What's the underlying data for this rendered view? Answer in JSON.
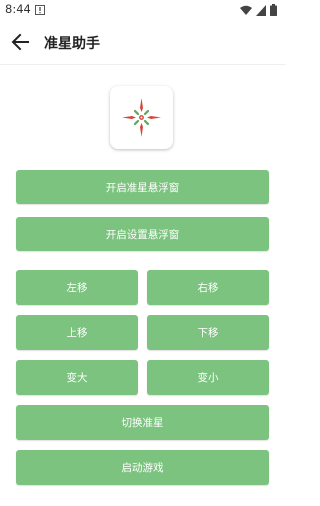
{
  "status_bar": {
    "time": "8:44"
  },
  "app_bar": {
    "title": "准星助手"
  },
  "buttons": {
    "open_crosshair_float": "开启准星悬浮窗",
    "open_settings_float": "开启设置悬浮窗",
    "move_left": "左移",
    "move_right": "右移",
    "move_up": "上移",
    "move_down": "下移",
    "enlarge": "变大",
    "shrink": "变小",
    "switch_crosshair": "切换准星",
    "launch_game": "启动游戏"
  },
  "colors": {
    "button_bg": "#7dc380",
    "button_text": "#ffffff",
    "crosshair_red": "#d9453a",
    "crosshair_green": "#5aa85d"
  },
  "icons": {
    "back": "arrow-left-icon",
    "wifi": "wifi-icon",
    "signal": "signal-icon",
    "battery": "battery-icon",
    "warning": "warning-icon",
    "logo": "crosshair-logo-icon"
  }
}
